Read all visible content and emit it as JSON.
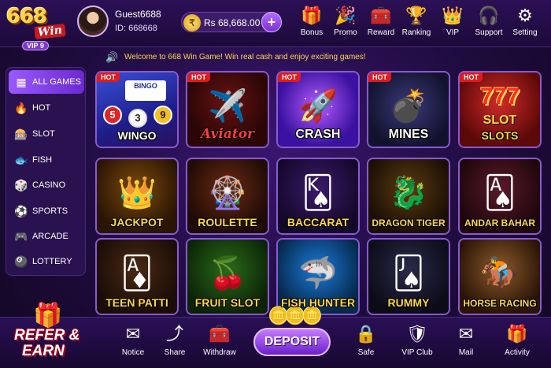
{
  "brand": {
    "logo_number": "668",
    "logo_word": "Win",
    "vip_badge": "VIP 9"
  },
  "user": {
    "name": "Guest6688",
    "id": "ID: 668668"
  },
  "wallet": {
    "balance": "Rs 68,668.00",
    "add_icon": "+"
  },
  "top_nav": [
    {
      "label": "Bonus",
      "icon": "gift-icon"
    },
    {
      "label": "Promo",
      "icon": "party-popper-icon"
    },
    {
      "label": "Reward",
      "icon": "treasure-chest-icon"
    },
    {
      "label": "Ranking",
      "icon": "podium-icon"
    },
    {
      "label": "VIP",
      "icon": "crown-icon"
    },
    {
      "label": "Support",
      "icon": "headset-icon"
    },
    {
      "label": "Setting",
      "icon": "gear-icon"
    }
  ],
  "marquee": {
    "text": "Welcome to 668 Win Game! Win real cash and enjoy exciting games!"
  },
  "sidebar": {
    "items": [
      {
        "label": "ALL GAMES",
        "icon": "all-games-icon",
        "active": true
      },
      {
        "label": "HOT",
        "icon": "fire-icon"
      },
      {
        "label": "SLOT",
        "icon": "slot-icon"
      },
      {
        "label": "FISH",
        "icon": "fish-icon"
      },
      {
        "label": "CASINO",
        "icon": "chip-icon"
      },
      {
        "label": "SPORTS",
        "icon": "soccer-ball-icon"
      },
      {
        "label": "ARCADE",
        "icon": "gamepad-icon"
      },
      {
        "label": "LOTTERY",
        "icon": "lottery-ball-icon"
      }
    ]
  },
  "games": [
    {
      "title": "WINGO",
      "hot": "HOT"
    },
    {
      "title": "Aviator",
      "hot": "HOT"
    },
    {
      "title": "CRASH",
      "hot": "HOT"
    },
    {
      "title": "MINES",
      "hot": "HOT"
    },
    {
      "title": "SLOTS",
      "hot": "HOT",
      "art_text": "777",
      "sub_text": "SLOT"
    },
    {
      "title": "JACKPOT"
    },
    {
      "title": "ROULETTE"
    },
    {
      "title": "BACCARAT"
    },
    {
      "title": "DRAGON TIGER"
    },
    {
      "title": "ANDAR BAHAR"
    },
    {
      "title": "TEEN PATTI"
    },
    {
      "title": "FRUIT SLOT"
    },
    {
      "title": "FISH HUNTER"
    },
    {
      "title": "RUMMY"
    },
    {
      "title": "HORSE RACING"
    }
  ],
  "wingo_art": {
    "bingo": "BINGO",
    "balls": [
      "5",
      "3",
      "9"
    ]
  },
  "refer": {
    "line1": "REFER &",
    "line2": "EARN"
  },
  "bottom_nav": [
    {
      "label": "Notice",
      "icon": "envelope-icon"
    },
    {
      "label": "Share",
      "icon": "share-icon"
    },
    {
      "label": "Withdraw",
      "icon": "treasure-chest-icon"
    },
    {
      "label": "Safe",
      "icon": "safe-icon"
    },
    {
      "label": "VIP Club",
      "icon": "vip-shield-icon"
    },
    {
      "label": "Mail",
      "icon": "mail-icon"
    },
    {
      "label": "Activity",
      "icon": "gift-icon"
    }
  ],
  "deposit": {
    "label": "DEPOSIT"
  }
}
